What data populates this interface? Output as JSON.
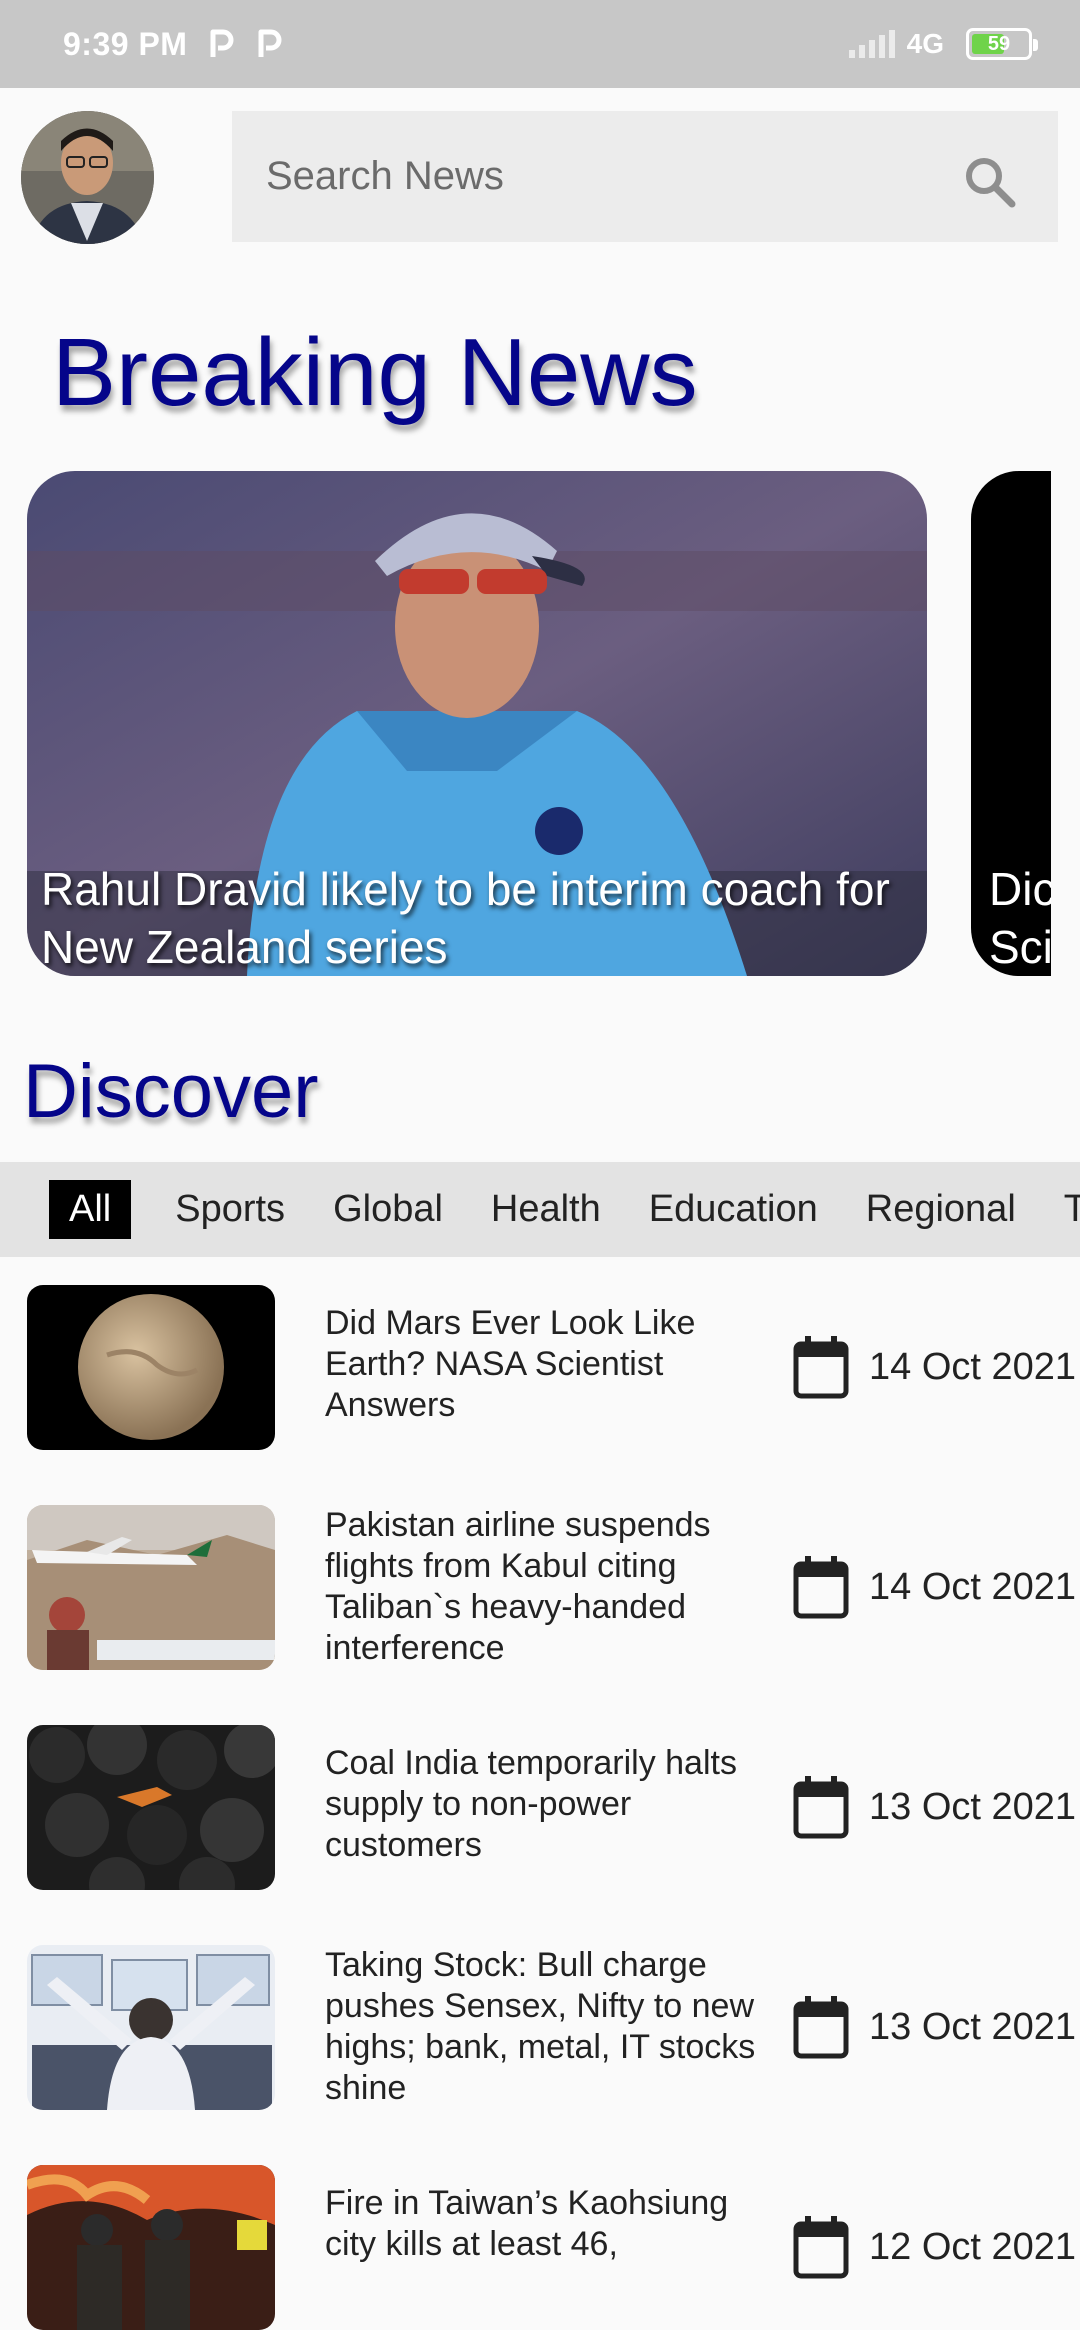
{
  "status_bar": {
    "time": "9:39 PM",
    "network": "4G",
    "battery": "59",
    "battery_level": 0.59
  },
  "search": {
    "placeholder": "Search News"
  },
  "breaking_news": {
    "title": "Breaking News",
    "cards": [
      {
        "caption": "Rahul Dravid likely to be interim coach for New Zealand series"
      },
      {
        "caption": "Did Mars Ever Look Like Earth? NASA Scientist Answers",
        "visible_line1": "Dic",
        "visible_line2": "Sci"
      }
    ]
  },
  "discover": {
    "title": "Discover",
    "tabs": [
      "All",
      "Sports",
      "Global",
      "Health",
      "Education",
      "Regional",
      "T"
    ]
  },
  "news": [
    {
      "title": "Did Mars Ever Look Like Earth? NASA Scientist Answers",
      "date": "14 Oct 2021",
      "icon": "calendar-icon"
    },
    {
      "title": "Pakistan airline suspends flights from Kabul citing Taliban`s heavy-handed interference",
      "date": "14 Oct 2021",
      "icon": "calendar-icon"
    },
    {
      "title": "Coal India temporarily halts supply to non-power customers",
      "date": "13 Oct 2021",
      "icon": "calendar-icon"
    },
    {
      "title": "Taking Stock: Bull charge pushes Sensex, Nifty to new highs; bank, metal, IT stocks shine",
      "date": "13 Oct 2021",
      "icon": "calendar-icon"
    },
    {
      "title": "Fire in Taiwan’s Kaohsiung city kills at least 46,",
      "date": "12 Oct 2021",
      "icon": "calendar-icon"
    }
  ],
  "colors": {
    "accent": "#05058a",
    "status_bar": "#c7c7c7",
    "tab_active_bg": "#000000"
  }
}
